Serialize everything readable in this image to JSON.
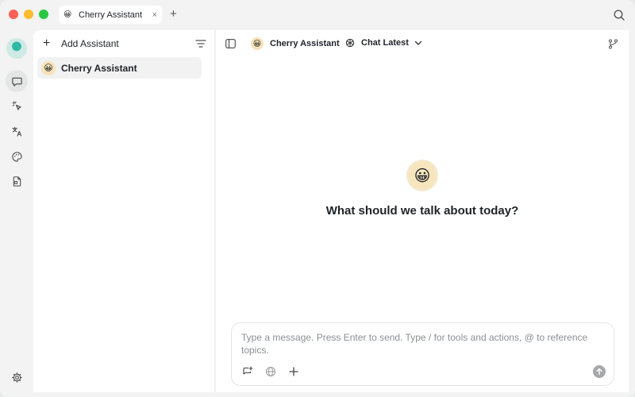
{
  "tab": {
    "emoji": "😀",
    "title": "Cherry Assistant",
    "close": "×",
    "add": "+"
  },
  "rail": {
    "items": [
      {
        "name": "chat",
        "icon": "chat-bubble-icon"
      },
      {
        "name": "agents",
        "icon": "sparkle-cursor-icon"
      },
      {
        "name": "translate",
        "icon": "translate-icon"
      },
      {
        "name": "paint",
        "icon": "palette-icon"
      },
      {
        "name": "files",
        "icon": "document-icon"
      }
    ],
    "settings_icon": "gear-icon"
  },
  "assistants": {
    "add_plus": "+",
    "add_label": "Add Assistant",
    "items": [
      {
        "emoji": "😀",
        "name": "Cherry Assistant"
      }
    ]
  },
  "header": {
    "assistant_emoji": "😀",
    "assistant_name": "Cherry Assistant",
    "model_name": "Chat Latest"
  },
  "welcome": {
    "emoji": "😀",
    "text": "What should we talk about today?"
  },
  "composer": {
    "placeholder": "Type a message. Press Enter to send. Type / for tools and actions, @ to reference topics.",
    "value": ""
  }
}
